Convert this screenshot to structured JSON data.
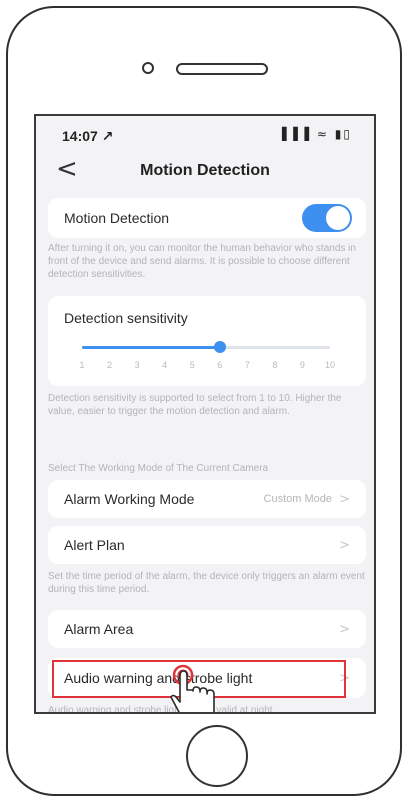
{
  "status_bar": {
    "time": "14:07 ↗",
    "icons": "▐▐▐ ≈ ▮▯"
  },
  "nav": {
    "back_glyph": "<",
    "title": "Motion Detection"
  },
  "motion": {
    "label": "Motion Detection",
    "enabled": true,
    "description": "After turning it on, you can monitor the human behavior who stands in front of the device and send alarms. It is possible to choose different detection sensitivities."
  },
  "sensitivity": {
    "label": "Detection sensitivity",
    "min": 1,
    "max": 10,
    "value": 6,
    "ticks": [
      "1",
      "2",
      "3",
      "4",
      "5",
      "6",
      "7",
      "8",
      "9",
      "10"
    ],
    "description": "Detection sensitivity is supported to select from 1 to 10. Higher the value, easier to trigger the motion detection and alarm."
  },
  "working_mode": {
    "section_title": "Select The Working Mode of The Current Camera",
    "alarm_working_mode": {
      "label": "Alarm Working Mode",
      "value": "Custom Mode",
      "chevron": ">"
    },
    "alert_plan": {
      "label": "Alert Plan",
      "chevron": ">"
    },
    "alert_plan_description": "Set the time period of the alarm, the device only triggers an alarm event during this time period."
  },
  "alarm_area": {
    "label": "Alarm Area",
    "chevron": ">"
  },
  "audio_warning": {
    "label": "Audio warning and strobe light",
    "chevron": ">",
    "description": "Audio warning and strobe light is only valid at night"
  },
  "colors": {
    "accent": "#3d8ff0",
    "highlight": "#e0333a",
    "screen_bg": "#f3f3f5"
  }
}
